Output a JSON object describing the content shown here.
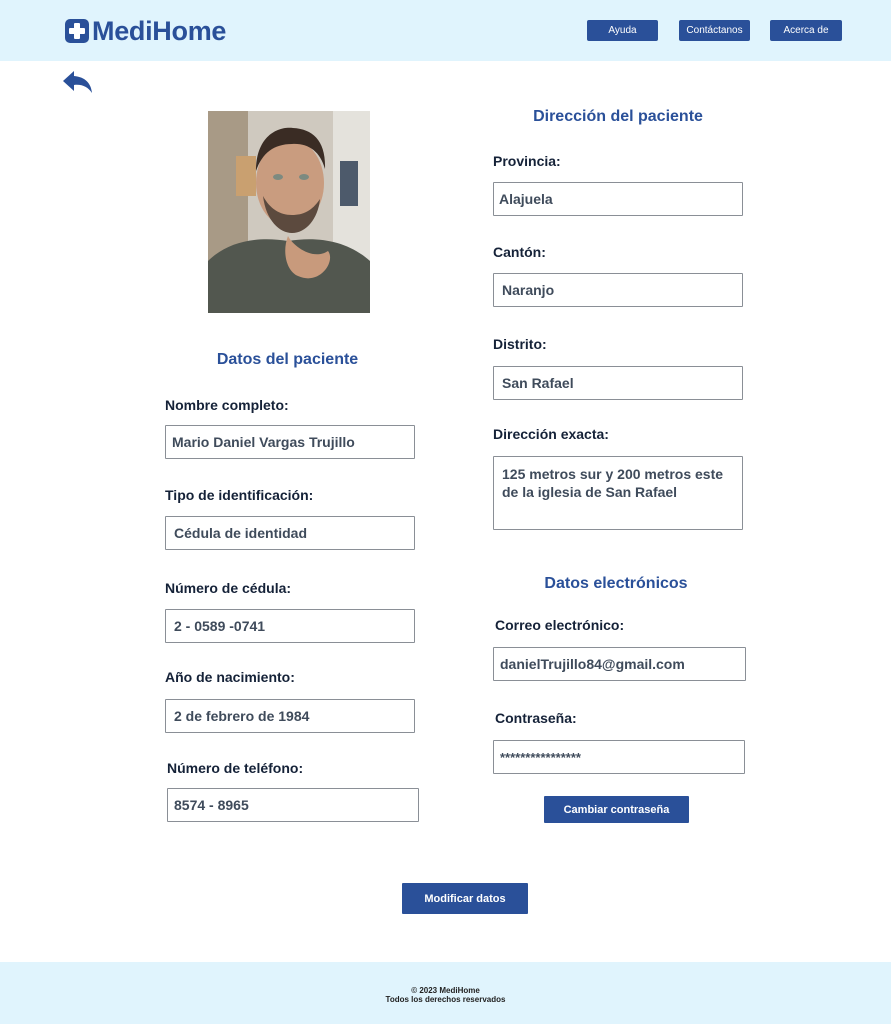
{
  "brand": {
    "name": "MediHome",
    "icon": "medical-cross-icon",
    "color": "#2a5099"
  },
  "nav": {
    "help": "Ayuda",
    "contact": "Contáctanos",
    "about": "Acerca de"
  },
  "back_icon": "back-arrow-icon",
  "patient": {
    "title": "Datos del paciente",
    "full_name_label": "Nombre completo:",
    "full_name": "Mario Daniel Vargas Trujillo",
    "id_type_label": "Tipo de identificación:",
    "id_type": "Cédula de identidad",
    "id_number_label": "Número de cédula:",
    "id_number": "2 - 0589 -0741",
    "birth_label": "Año de nacimiento:",
    "birth": "2 de febrero de 1984",
    "phone_label": "Número de teléfono:",
    "phone": "8574 - 8965"
  },
  "address": {
    "title": "Dirección del  paciente",
    "province_label": "Provincia:",
    "province": "Alajuela",
    "canton_label": "Cantón:",
    "canton": "Naranjo",
    "district_label": "Distrito:",
    "district": "San Rafael",
    "exact_label": "Dirección exacta:",
    "exact": "125 metros sur y 200 metros este de la iglesia de San Rafael"
  },
  "electronic": {
    "title": "Datos electrónicos",
    "email_label": "Correo electrónico:",
    "email": "danielTrujillo84@gmail.com",
    "password_label": "Contraseña:",
    "password": "****************",
    "change_password": "Cambiar contraseña"
  },
  "modify_button": "Modificar datos",
  "footer": {
    "copyright": "© 2023 MediHome",
    "rights": "Todos los derechos reservados"
  }
}
